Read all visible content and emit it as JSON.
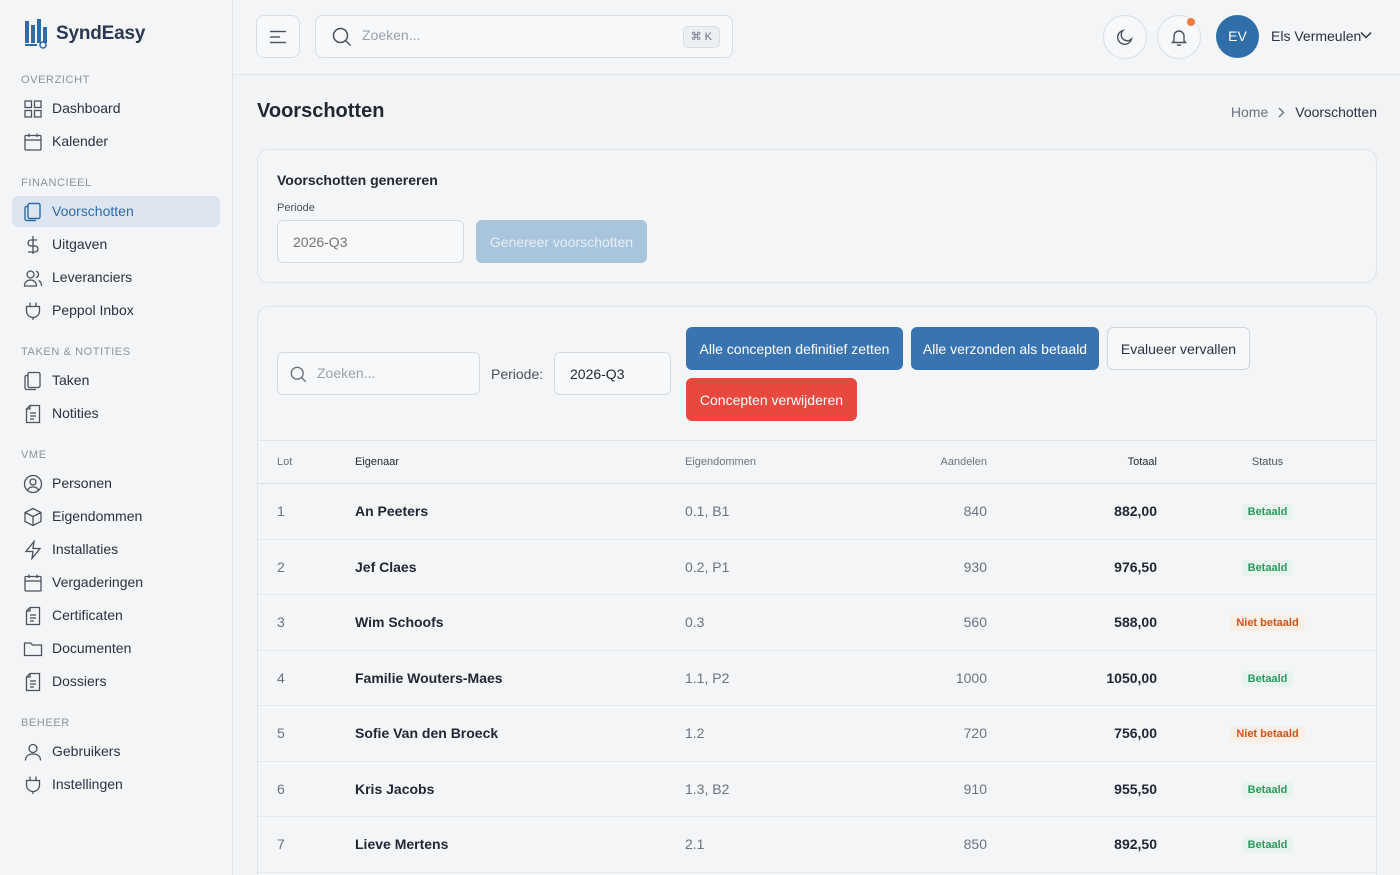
{
  "app": {
    "name": "SyndEasy"
  },
  "sidebar": {
    "sections": [
      {
        "title": "OVERZICHT",
        "items": [
          {
            "label": "Dashboard",
            "icon": "dashboard-icon"
          },
          {
            "label": "Kalender",
            "icon": "calendar-icon"
          }
        ]
      },
      {
        "title": "FINANCIEEL",
        "items": [
          {
            "label": "Voorschotten",
            "icon": "document-icon",
            "active": true
          },
          {
            "label": "Uitgaven",
            "icon": "dollar-icon"
          },
          {
            "label": "Leveranciers",
            "icon": "users-icon"
          },
          {
            "label": "Peppol Inbox",
            "icon": "plug-icon"
          }
        ]
      },
      {
        "title": "TAKEN & NOTITIES",
        "items": [
          {
            "label": "Taken",
            "icon": "copy-icon"
          },
          {
            "label": "Notities",
            "icon": "note-icon"
          }
        ]
      },
      {
        "title": "VME",
        "items": [
          {
            "label": "Personen",
            "icon": "person-circle-icon"
          },
          {
            "label": "Eigendommen",
            "icon": "box-icon"
          },
          {
            "label": "Installaties",
            "icon": "bolt-icon"
          },
          {
            "label": "Vergaderingen",
            "icon": "calendar-icon"
          },
          {
            "label": "Certificaten",
            "icon": "note-icon"
          },
          {
            "label": "Documenten",
            "icon": "folder-icon"
          },
          {
            "label": "Dossiers",
            "icon": "note-icon"
          }
        ]
      },
      {
        "title": "BEHEER",
        "items": [
          {
            "label": "Gebruikers",
            "icon": "user-icon"
          },
          {
            "label": "Instellingen",
            "icon": "plug-icon"
          }
        ]
      }
    ]
  },
  "topbar": {
    "search_placeholder": "Zoeken...",
    "shortcut": "⌘ K",
    "user_initials": "EV",
    "user_name": "Els Vermeulen",
    "notification_dot_color": "#f07a3f"
  },
  "page": {
    "title": "Voorschotten",
    "breadcrumb": {
      "home": "Home",
      "current": "Voorschotten"
    }
  },
  "generate": {
    "title": "Voorschotten genereren",
    "period_label": "Periode",
    "period_placeholder": "2026-Q3",
    "button": "Genereer voorschotten"
  },
  "filters": {
    "search_placeholder": "Zoeken...",
    "period_label": "Periode:",
    "period_value": "2026-Q3",
    "actions": {
      "finalize": "Alle concepten definitief zetten",
      "mark_paid": "Alle verzonden als betaald",
      "evaluate": "Evalueer vervallen",
      "delete": "Concepten verwijderen"
    }
  },
  "table": {
    "columns": [
      "Lot",
      "Eigenaar",
      "Eigendommen",
      "Aandelen",
      "Totaal",
      "Status"
    ],
    "rows": [
      {
        "lot": "1",
        "owner": "An Peeters",
        "properties": "0.1, B1",
        "shares": "840",
        "total": "882,00",
        "status": "Betaald",
        "paid": true
      },
      {
        "lot": "2",
        "owner": "Jef Claes",
        "properties": "0.2, P1",
        "shares": "930",
        "total": "976,50",
        "status": "Betaald",
        "paid": true
      },
      {
        "lot": "3",
        "owner": "Wim Schoofs",
        "properties": "0.3",
        "shares": "560",
        "total": "588,00",
        "status": "Niet betaald",
        "paid": false
      },
      {
        "lot": "4",
        "owner": "Familie Wouters-Maes",
        "properties": "1.1, P2",
        "shares": "1000",
        "total": "1050,00",
        "status": "Betaald",
        "paid": true
      },
      {
        "lot": "5",
        "owner": "Sofie Van den Broeck",
        "properties": "1.2",
        "shares": "720",
        "total": "756,00",
        "status": "Niet betaald",
        "paid": false
      },
      {
        "lot": "6",
        "owner": "Kris Jacobs",
        "properties": "1.3, B2",
        "shares": "910",
        "total": "955,50",
        "status": "Betaald",
        "paid": true
      },
      {
        "lot": "7",
        "owner": "Lieve Mertens",
        "properties": "2.1",
        "shares": "850",
        "total": "892,50",
        "status": "Betaald",
        "paid": true
      }
    ]
  },
  "colors": {
    "primary": "#3a74b0",
    "danger": "#e8483e",
    "paid": "#2d9a5e",
    "unpaid": "#c7561c",
    "avatar": "#2f6ea8"
  }
}
